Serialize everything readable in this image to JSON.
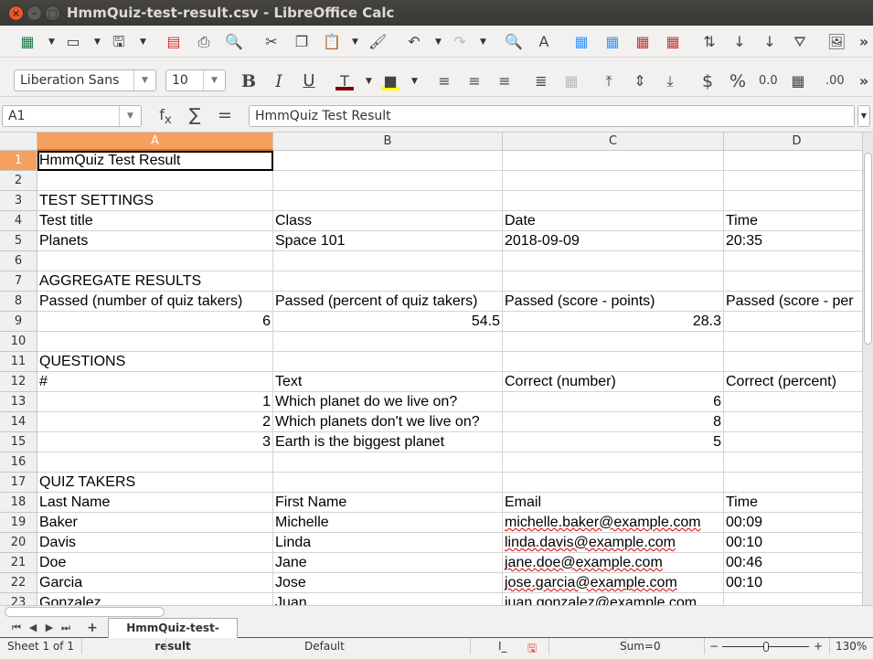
{
  "window": {
    "title": "HmmQuiz-test-result.csv - LibreOffice Calc"
  },
  "toolbar": {
    "font_name": "Liberation Sans",
    "font_size": "10",
    "font_color": "#800000",
    "highlight_color": "#ffff00",
    "more": "»"
  },
  "formula_bar": {
    "name_box": "A1",
    "content": "HmmQuiz Test Result"
  },
  "columns": [
    "A",
    "B",
    "C",
    "D"
  ],
  "rows": [
    [
      "HmmQuiz Test Result",
      "",
      "",
      ""
    ],
    [
      "",
      "",
      "",
      ""
    ],
    [
      "TEST SETTINGS",
      "",
      "",
      ""
    ],
    [
      "Test title",
      "Class",
      "Date",
      "Time"
    ],
    [
      "Planets",
      "Space 101",
      "2018-09-09",
      "20:35"
    ],
    [
      "",
      "",
      "",
      ""
    ],
    [
      "AGGREGATE RESULTS",
      "",
      "",
      ""
    ],
    [
      "Passed (number of quiz takers)",
      "Passed (percent of quiz takers)",
      "Passed (score - points)",
      "Passed (score - per"
    ],
    [
      "6",
      "54.5",
      "28.3",
      ""
    ],
    [
      "",
      "",
      "",
      ""
    ],
    [
      "QUESTIONS",
      "",
      "",
      ""
    ],
    [
      "#",
      "Text",
      "Correct (number)",
      "Correct (percent)"
    ],
    [
      "1",
      "Which planet do we live on?",
      "6",
      ""
    ],
    [
      "2",
      "Which planets don't we live on?",
      "8",
      ""
    ],
    [
      "3",
      "Earth is the biggest planet",
      "5",
      ""
    ],
    [
      "",
      "",
      "",
      ""
    ],
    [
      "QUIZ TAKERS",
      "",
      "",
      ""
    ],
    [
      "Last Name",
      "First Name",
      "Email",
      "Time"
    ],
    [
      "Baker",
      "Michelle",
      "michelle.baker@example.com",
      "00:09"
    ],
    [
      "Davis",
      "Linda",
      "linda.davis@example.com",
      "00:10"
    ],
    [
      "Doe",
      "Jane",
      "jane.doe@example.com",
      "00:46"
    ],
    [
      "Garcia",
      "Jose",
      "jose.garcia@example.com",
      "00:10"
    ],
    [
      "Gonzalez",
      "Juan",
      "juan.gonzalez@example.com",
      ""
    ]
  ],
  "numeric_cells": [
    "9-0",
    "9-1",
    "9-2",
    "13-0",
    "13-2",
    "14-0",
    "14-2",
    "15-0",
    "15-2"
  ],
  "sheet_tabs": [
    {
      "label": "HmmQuiz-test-result",
      "active": true
    }
  ],
  "status": {
    "sheet": "Sheet 1 of 1",
    "style": "Default",
    "sum": "Sum=0",
    "zoom": "130%",
    "zoom_minus": "−",
    "zoom_plus": "+"
  }
}
